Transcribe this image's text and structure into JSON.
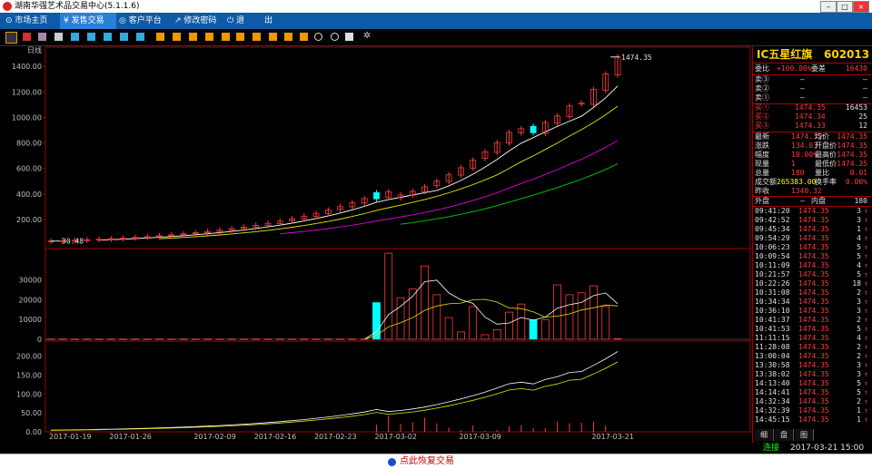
{
  "window": {
    "title": "湖南华强艺术品交易中心(5.1.1.6)"
  },
  "menu": {
    "items": [
      {
        "label": "⊙ 市场主页"
      },
      {
        "label": "¥ 发售交易"
      },
      {
        "label": "◎ 客户平台"
      },
      {
        "label": "↗ 修改密码"
      },
      {
        "label": "⏻ 退"
      },
      {
        "label": "出"
      }
    ]
  },
  "chart": {
    "period_label": "日线",
    "last_price_label": "1474.35",
    "start_price_label": "30.48"
  },
  "chart_data": [
    {
      "type": "candlestick",
      "title": "",
      "x_tick_labels": [
        "2017-01-19",
        "2017-01-26",
        "2017-02-09",
        "2017-02-16",
        "2017-02-23",
        "2017-03-02",
        "2017-03-09",
        "2017-03-21"
      ],
      "y_ticks": [
        200,
        400,
        600,
        800,
        1000,
        1200,
        1400
      ],
      "ylim": [
        0,
        1480
      ],
      "close": [
        30.48,
        33.53,
        36.88,
        40.57,
        44.63,
        49.09,
        54.0,
        59.4,
        65.34,
        71.87,
        79.06,
        86.97,
        95.66,
        105.23,
        115.75,
        127.33,
        140.06,
        154.07,
        169.47,
        186.42,
        205.07,
        225.57,
        248.13,
        272.94,
        300.24,
        330.26,
        363.29,
        410,
        372,
        392,
        420,
        455,
        500,
        550,
        605,
        665,
        730,
        803,
        883,
        912,
        880,
        960,
        1012,
        1090,
        1108,
        1219,
        1340.32,
        1474.35
      ],
      "moving_averages": [
        "white",
        "yellow",
        "magenta",
        "green"
      ]
    },
    {
      "type": "bar",
      "title": "",
      "y_ticks": [
        0,
        10000,
        20000,
        30000
      ],
      "ylim": [
        0,
        44000
      ],
      "volume": [
        100,
        100,
        100,
        100,
        100,
        100,
        100,
        100,
        100,
        100,
        100,
        100,
        100,
        100,
        100,
        100,
        100,
        100,
        100,
        100,
        100,
        100,
        100,
        100,
        100,
        100,
        100,
        18500,
        43500,
        21000,
        25500,
        37000,
        22500,
        11000,
        3700,
        16500,
        2300,
        4800,
        13700,
        17800,
        9800,
        9800,
        27500,
        22500,
        23500,
        27000,
        16500,
        300
      ]
    },
    {
      "type": "line",
      "title": "",
      "y_ticks": [
        0,
        50,
        100,
        150,
        200
      ],
      "ylim": [
        0,
        230
      ],
      "series": [
        {
          "values": "derived"
        }
      ]
    }
  ],
  "quote": {
    "title": "IC五星红旗",
    "code": "602013",
    "wei_bi": {
      "label": "委比",
      "value": "+100.00%",
      "diff_label": "委差",
      "diff": "16430"
    },
    "asks": [
      {
        "label": "卖③",
        "price": "—",
        "vol": "—"
      },
      {
        "label": "卖②",
        "price": "—",
        "vol": "—"
      },
      {
        "label": "卖①",
        "price": "—",
        "vol": "—"
      }
    ],
    "bids": [
      {
        "label": "买①",
        "price": "1474.35",
        "vol": "16453"
      },
      {
        "label": "买②",
        "price": "1474.34",
        "vol": "25"
      },
      {
        "label": "买③",
        "price": "1474.33",
        "vol": "12"
      }
    ],
    "stats": [
      {
        "l1": "最新",
        "v1": "1474.35",
        "l2": "均价",
        "v2": "1474.35"
      },
      {
        "l1": "涨跌",
        "v1": "134.03",
        "l2": "开盘价",
        "v2": "1474.35"
      },
      {
        "l1": "幅度",
        "v1": "10.00%",
        "l2": "最高价",
        "v2": "1474.35"
      },
      {
        "l1": "现量",
        "v1": "1",
        "l2": "最低价",
        "v2": "1474.35"
      },
      {
        "l1": "总量",
        "v1": "180",
        "l2": "量比",
        "v2": "0.01"
      },
      {
        "l1": "成交额",
        "v1": "265383.00",
        "l2": "换手率",
        "v2": "0.06%"
      },
      {
        "l1": "昨收",
        "v1": "1340.32",
        "l2": "",
        "v2": ""
      }
    ],
    "outer": {
      "label": "外盘",
      "value": "—",
      "inner_label": "内盘",
      "inner": "180"
    },
    "ticks": [
      {
        "time": "09:41:20",
        "price": "1474.35",
        "vol": "3"
      },
      {
        "time": "09:42:52",
        "price": "1474.35",
        "vol": "3"
      },
      {
        "time": "09:45:34",
        "price": "1474.35",
        "vol": "1"
      },
      {
        "time": "09:54:29",
        "price": "1474.35",
        "vol": "4"
      },
      {
        "time": "10:06:23",
        "price": "1474.35",
        "vol": "5"
      },
      {
        "time": "10:09:54",
        "price": "1474.35",
        "vol": "5"
      },
      {
        "time": "10:11:09",
        "price": "1474.35",
        "vol": "4"
      },
      {
        "time": "10:21:57",
        "price": "1474.35",
        "vol": "5"
      },
      {
        "time": "10:22:26",
        "price": "1474.35",
        "vol": "18"
      },
      {
        "time": "10:31:08",
        "price": "1474.35",
        "vol": "2"
      },
      {
        "time": "10:34:34",
        "price": "1474.35",
        "vol": "3"
      },
      {
        "time": "10:36:10",
        "price": "1474.35",
        "vol": "3"
      },
      {
        "time": "10:41:37",
        "price": "1474.35",
        "vol": "2"
      },
      {
        "time": "10:41:53",
        "price": "1474.35",
        "vol": "5"
      },
      {
        "time": "11:11:15",
        "price": "1474.35",
        "vol": "4"
      },
      {
        "time": "11:28:08",
        "price": "1474.35",
        "vol": "2"
      },
      {
        "time": "13:00:04",
        "price": "1474.35",
        "vol": "2"
      },
      {
        "time": "13:30:58",
        "price": "1474.35",
        "vol": "3"
      },
      {
        "time": "13:38:02",
        "price": "1474.35",
        "vol": "3"
      },
      {
        "time": "14:13:40",
        "price": "1474.35",
        "vol": "5"
      },
      {
        "time": "14:14:41",
        "price": "1474.35",
        "vol": "5"
      },
      {
        "time": "14:32:34",
        "price": "1474.35",
        "vol": "2"
      },
      {
        "time": "14:32:39",
        "price": "1474.35",
        "vol": "1"
      },
      {
        "time": "14:45:15",
        "price": "1474.35",
        "vol": "1"
      }
    ],
    "tabs": [
      "细",
      "盘",
      "图"
    ]
  },
  "status": {
    "connection": "连接",
    "datetime": "2017-03-21 15:00"
  },
  "footer": {
    "button": "点此恢复交易"
  },
  "colors": {
    "up": "#ff3c3c",
    "highlight": "#00ffff",
    "ma1": "#ffffff",
    "ma2": "#e6e600",
    "ma3": "#e000e0",
    "ma4": "#00d000",
    "axis": "#a00000"
  }
}
